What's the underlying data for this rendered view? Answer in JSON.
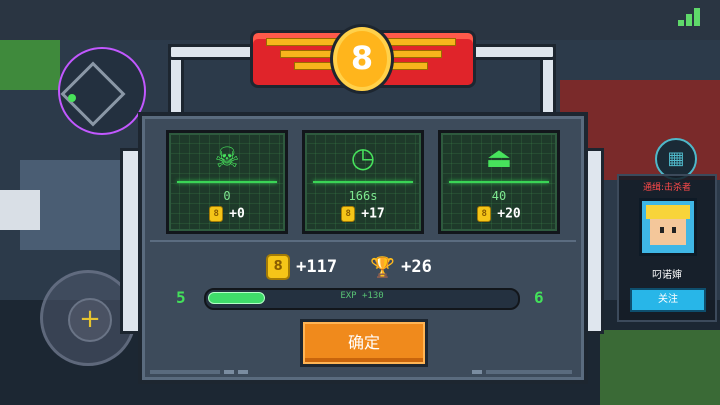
{
  "level_badge": {
    "level": "8"
  },
  "stats": [
    {
      "icon": "skull-icon",
      "glyph": "☠",
      "value": "0",
      "reward": "+0"
    },
    {
      "icon": "clock-icon",
      "glyph": "◷",
      "value": "166s",
      "reward": "+17"
    },
    {
      "icon": "weight-icon",
      "glyph": "⏏",
      "value": "40",
      "reward": "+20"
    }
  ],
  "totals": {
    "coins": "+117",
    "trophies": "+26"
  },
  "exp": {
    "current_level": "5",
    "next_level": "6",
    "text": "EXP +130",
    "fill_fraction": 0.18
  },
  "confirm_label": "确定",
  "player_card": {
    "title": "通缉:击杀者",
    "name": "叼诺婶",
    "follow_label": "关注"
  },
  "colors": {
    "accent_green": "#47e25c",
    "button_orange": "#f08a1c",
    "follow_blue": "#28b6e8",
    "badge_red": "#e0242a"
  }
}
